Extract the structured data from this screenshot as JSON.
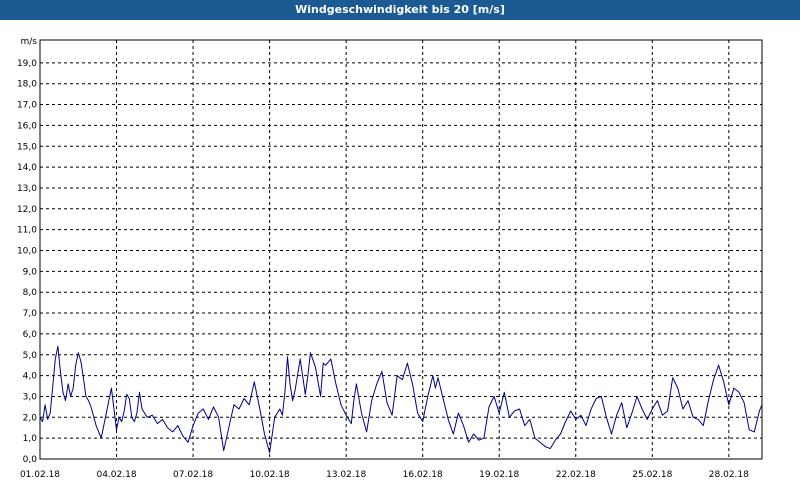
{
  "window": {
    "title": "Windgeschwindigkeit bis 20 [m/s]"
  },
  "colors": {
    "titlebar": "#1c5a93",
    "series": "#00008b",
    "grid": "#000000",
    "background": "#ffffff"
  },
  "chart_data": {
    "type": "line",
    "title": "Windgeschwindigkeit bis 20 [m/s]",
    "ylabel": "m/s",
    "ylim": [
      0,
      20
    ],
    "yticks": [
      "0,0",
      "1,0",
      "2,0",
      "3,0",
      "4,0",
      "5,0",
      "6,0",
      "7,0",
      "8,0",
      "9,0",
      "10,0",
      "11,0",
      "12,0",
      "13,0",
      "14,0",
      "15,0",
      "16,0",
      "17,0",
      "18,0",
      "19,0"
    ],
    "xticks": [
      "01.02.18",
      "04.02.18",
      "07.02.18",
      "10.02.18",
      "13.02.18",
      "16.02.18",
      "19.02.18",
      "22.02.18",
      "25.02.18",
      "28.02.18"
    ],
    "xlim_days": [
      0,
      28.3
    ],
    "grid": "dashed",
    "series": [
      {
        "x_days": [
          0,
          0.1,
          0.2,
          0.3,
          0.4,
          0.5,
          0.6,
          0.7,
          0.8,
          0.9,
          1.0,
          1.1,
          1.2,
          1.3,
          1.4,
          1.5,
          1.6,
          1.7,
          1.8,
          1.9,
          2.0,
          2.2,
          2.4,
          2.6,
          2.8,
          3.0,
          3.1,
          3.2,
          3.3,
          3.4,
          3.5,
          3.6,
          3.7,
          3.8,
          3.9,
          4.0,
          4.2,
          4.4,
          4.6,
          4.8,
          5.0,
          5.2,
          5.4,
          5.6,
          5.8,
          6.0,
          6.2,
          6.4,
          6.6,
          6.8,
          7.0,
          7.2,
          7.4,
          7.6,
          7.8,
          8.0,
          8.2,
          8.4,
          8.6,
          8.8,
          9.0,
          9.2,
          9.4,
          9.5,
          9.6,
          9.7,
          9.8,
          9.9,
          10.0,
          10.2,
          10.4,
          10.5,
          10.6,
          10.8,
          11.0,
          11.1,
          11.2,
          11.4,
          11.6,
          11.8,
          12.0,
          12.2,
          12.3,
          12.4,
          12.6,
          12.8,
          13.0,
          13.2,
          13.4,
          13.6,
          13.8,
          14.0,
          14.2,
          14.4,
          14.6,
          14.8,
          15.0,
          15.2,
          15.4,
          15.5,
          15.6,
          15.8,
          16.0,
          16.2,
          16.4,
          16.6,
          16.8,
          17.0,
          17.2,
          17.4,
          17.6,
          17.8,
          18.0,
          18.2,
          18.4,
          18.6,
          18.8,
          19.0,
          19.2,
          19.4,
          19.6,
          19.8,
          20.0,
          20.2,
          20.4,
          20.6,
          20.8,
          21.0,
          21.2,
          21.4,
          21.6,
          21.8,
          22.0,
          22.2,
          22.4,
          22.6,
          22.8,
          23.0,
          23.2,
          23.4,
          23.6,
          23.8,
          24.0,
          24.2,
          24.4,
          24.6,
          24.8,
          25.0,
          25.2,
          25.4,
          25.6,
          25.8,
          26.0,
          26.2,
          26.4,
          26.6,
          26.8,
          27.0,
          27.2,
          27.4,
          27.6,
          27.8,
          28.0,
          28.2,
          28.3
        ],
        "values": [
          2.0,
          1.8,
          2.6,
          1.9,
          2.2,
          3.5,
          4.8,
          5.4,
          4.2,
          3.2,
          2.8,
          3.6,
          3.0,
          3.4,
          4.5,
          5.1,
          4.7,
          3.9,
          3.0,
          2.8,
          2.5,
          1.6,
          1.0,
          2.2,
          3.4,
          1.4,
          2.0,
          1.8,
          2.3,
          3.1,
          2.9,
          2.0,
          1.8,
          2.2,
          3.2,
          2.4,
          2.0,
          2.1,
          1.7,
          1.9,
          1.5,
          1.3,
          1.6,
          1.1,
          0.8,
          1.6,
          2.2,
          2.4,
          1.9,
          2.5,
          2.0,
          0.4,
          1.5,
          2.6,
          2.4,
          2.9,
          2.6,
          3.7,
          2.5,
          1.2,
          0.3,
          2.0,
          2.4,
          2.1,
          3.2,
          4.9,
          3.6,
          2.8,
          3.3,
          4.8,
          3.1,
          4.0,
          5.1,
          4.4,
          3.0,
          4.6,
          4.5,
          4.8,
          3.6,
          2.6,
          2.1,
          1.7,
          2.8,
          3.6,
          2.2,
          1.3,
          2.8,
          3.6,
          4.2,
          2.7,
          2.1,
          4.0,
          3.8,
          4.6,
          3.6,
          2.2,
          1.8,
          3.0,
          4.0,
          3.4,
          3.9,
          2.9,
          1.9,
          1.2,
          2.2,
          1.6,
          0.8,
          1.2,
          0.9,
          1.0,
          2.5,
          3.0,
          2.2,
          3.2,
          2.0,
          2.3,
          2.4,
          1.6,
          1.9,
          1.0,
          0.8,
          0.6,
          0.5,
          0.9,
          1.2,
          1.8,
          2.3,
          1.9,
          2.1,
          1.6,
          2.4,
          2.9,
          3.0,
          2.0,
          1.2,
          2.1,
          2.7,
          1.5,
          2.2,
          3.0,
          2.4,
          1.9,
          2.4,
          2.8,
          2.1,
          2.3,
          3.9,
          3.4,
          2.4,
          2.8,
          2.0,
          1.9,
          1.6,
          2.8,
          3.8,
          4.5,
          3.7,
          2.6,
          3.4,
          3.2,
          2.7,
          1.4,
          1.3,
          2.3,
          2.6,
          2.8,
          3.0,
          2.7
        ]
      }
    ]
  }
}
